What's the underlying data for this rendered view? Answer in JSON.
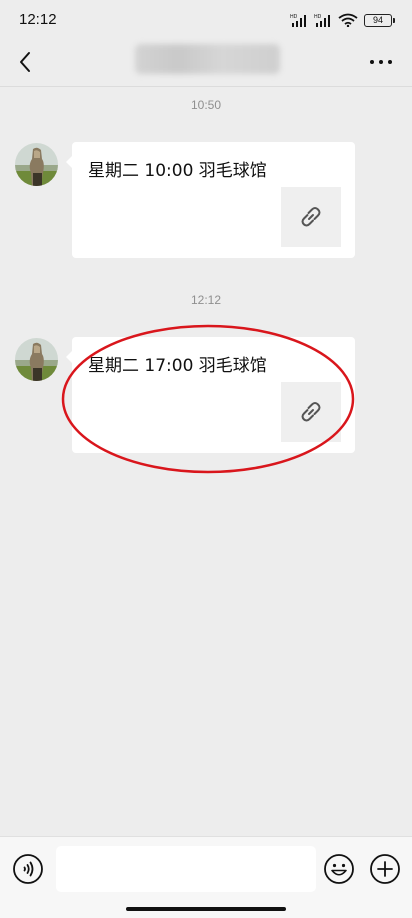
{
  "status_bar": {
    "time": "12:12",
    "signal_label": "HD",
    "battery": "94"
  },
  "header": {
    "back_icon": "chevron-left-icon",
    "more_icon": "ellipsis-icon"
  },
  "messages": [
    {
      "timestamp": "10:50",
      "text": "星期二 10:00 羽毛球馆",
      "link_icon": "link-icon"
    },
    {
      "timestamp": "12:12",
      "text": "星期二 17:00 羽毛球馆",
      "link_icon": "link-icon",
      "highlighted": true
    }
  ],
  "input_bar": {
    "voice_icon": "voice-icon",
    "input_value": "",
    "emoji_icon": "emoji-icon",
    "plus_icon": "plus-icon"
  },
  "colors": {
    "background": "#ededed",
    "bubble": "#ffffff",
    "highlight": "#d9161c"
  }
}
